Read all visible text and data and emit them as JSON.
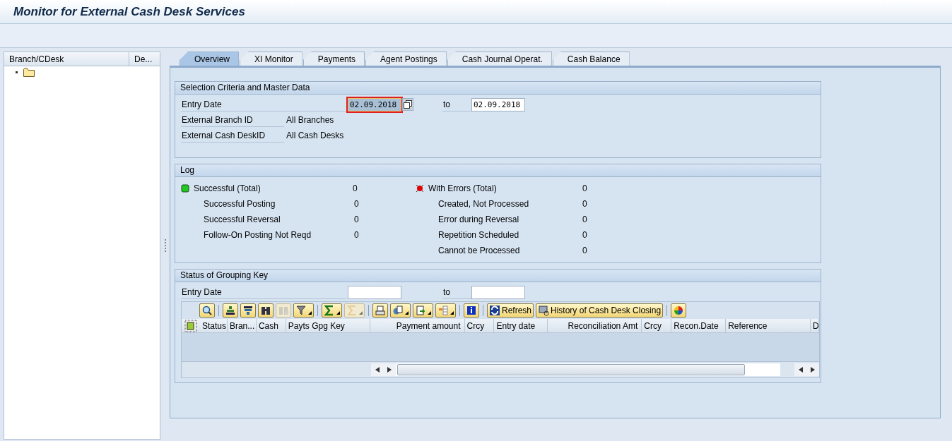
{
  "window": {
    "title": "Monitor for External Cash Desk Services"
  },
  "tree": {
    "columns": [
      "Branch/CDesk",
      "De..."
    ],
    "items": [
      {
        "kind": "folder"
      }
    ]
  },
  "tabs": [
    {
      "label": "Overview",
      "selected": true
    },
    {
      "label": "XI Monitor",
      "selected": false
    },
    {
      "label": "Payments",
      "selected": false
    },
    {
      "label": "Agent Postings",
      "selected": false
    },
    {
      "label": "Cash Journal Operat.",
      "selected": false
    },
    {
      "label": "Cash Balance",
      "selected": false
    }
  ],
  "selection": {
    "title": "Selection Criteria and Master Data",
    "entry_date": {
      "label": "Entry Date",
      "from": {
        "value": "02.09.2018",
        "focused": true
      },
      "to_label": "to",
      "to": {
        "value": "02.09.2018",
        "focused": false
      }
    },
    "rows": [
      {
        "label": "External Branch ID",
        "value": "All Branches"
      },
      {
        "label": "External Cash DeskID",
        "value": "All Cash Desks"
      }
    ]
  },
  "log": {
    "title": "Log",
    "groups": [
      {
        "total": {
          "label": "Successful (Total)",
          "value": "0",
          "color": "#22c822",
          "kind": "square"
        },
        "details": [
          {
            "label": "Successful Posting",
            "value": "0"
          },
          {
            "label": "Successful Reversal",
            "value": "0"
          },
          {
            "label": "Follow-On Posting Not Reqd",
            "value": "0"
          }
        ]
      },
      {
        "total": {
          "label": "With Errors (Total)",
          "value": "0",
          "color": "#e00000",
          "kind": "light"
        },
        "details": [
          {
            "label": "Created, Not Processed",
            "value": "0"
          },
          {
            "label": "Error during Reversal",
            "value": "0"
          },
          {
            "label": "Repetition Scheduled",
            "value": "0"
          },
          {
            "label": "Cannot be Processed",
            "value": "0"
          }
        ]
      }
    ]
  },
  "grouping": {
    "title": "Status of Grouping Key",
    "entry_date": {
      "label": "Entry Date",
      "to_label": "to"
    },
    "toolbar": [
      {
        "kind": "icon",
        "menu": false,
        "disabled": false
      },
      {
        "kind": "separator"
      },
      {
        "kind": "icon",
        "menu": false,
        "disabled": false
      },
      {
        "kind": "icon",
        "menu": false,
        "disabled": false
      },
      {
        "kind": "icon",
        "menu": false,
        "disabled": false
      },
      {
        "kind": "icon",
        "menu": false,
        "disabled": true
      },
      {
        "kind": "icon",
        "menu": true,
        "disabled": false
      },
      {
        "kind": "separator"
      },
      {
        "kind": "icon",
        "menu": true,
        "disabled": false
      },
      {
        "kind": "icon",
        "menu": true,
        "disabled": true
      },
      {
        "kind": "separator"
      },
      {
        "kind": "icon",
        "menu": false,
        "disabled": false
      },
      {
        "kind": "icon",
        "menu": true,
        "disabled": false
      },
      {
        "kind": "icon",
        "menu": true,
        "disabled": false
      },
      {
        "kind": "icon",
        "menu": true,
        "disabled": false
      },
      {
        "kind": "separator"
      },
      {
        "kind": "icon",
        "menu": false,
        "disabled": false
      },
      {
        "kind": "separator"
      },
      {
        "kind": "text",
        "label": "Refresh",
        "menu": false,
        "disabled": false
      },
      {
        "kind": "text",
        "label": "History of Cash Desk Closing",
        "menu": false,
        "disabled": false
      },
      {
        "kind": "separator"
      },
      {
        "kind": "icon",
        "menu": false,
        "disabled": false
      }
    ],
    "columns": [
      "Status",
      "Bran...",
      "Cash",
      "Payts Gpg Key",
      "Payment amount",
      "Crcy",
      "Entry date",
      "Reconciliation Amt",
      "Crcy",
      "Recon.Date",
      "Reference",
      "D"
    ]
  }
}
